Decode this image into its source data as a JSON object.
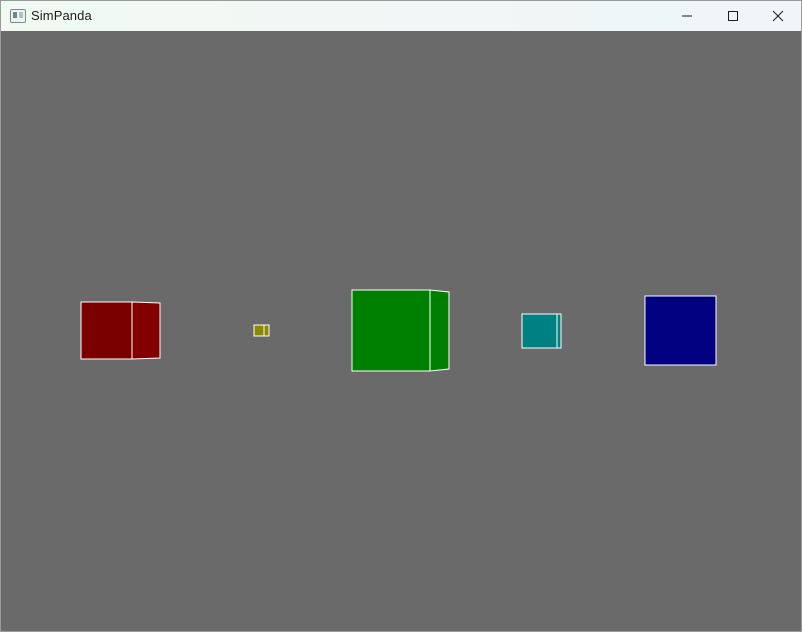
{
  "window": {
    "title": "SimPanda",
    "icons": {
      "app": "app-window-icon",
      "minimize": "minimize-icon",
      "maximize": "maximize-icon",
      "close": "close-icon"
    }
  },
  "scene": {
    "background": "#6a6a6a",
    "edge_color": "#ffffff",
    "cubes": [
      {
        "name": "red-cube",
        "front": "#7a0000",
        "side": "#820000"
      },
      {
        "name": "yellow-cube",
        "front": "#8a8a00",
        "side": "#8a8a00"
      },
      {
        "name": "green-cube",
        "front": "#008000",
        "side": "#008000"
      },
      {
        "name": "teal-cube",
        "front": "#008080",
        "side": "#008080"
      },
      {
        "name": "blue-cube",
        "front": "#000080",
        "side": "#000080"
      }
    ]
  }
}
